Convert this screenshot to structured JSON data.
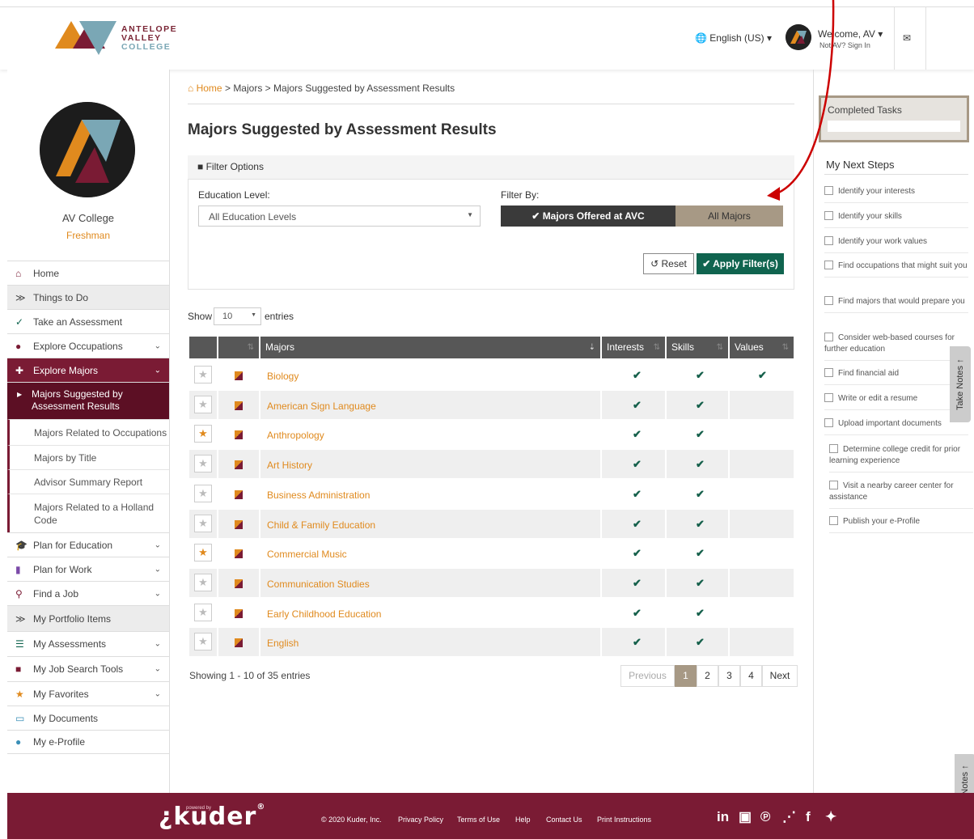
{
  "header": {
    "logo_lines": [
      "ANTELOPE",
      "VALLEY",
      "COLLEGE"
    ],
    "language": "English (US)",
    "welcome": "Welcome, AV",
    "signin": "Not AV? Sign In"
  },
  "sidebar": {
    "name": "AV College",
    "year": "Freshman",
    "nav": [
      {
        "label": "Home"
      },
      {
        "label": "Things to Do"
      },
      {
        "label": "Take an Assessment"
      },
      {
        "label": "Explore Occupations"
      },
      {
        "label": "Explore Majors"
      },
      {
        "label": "Majors Suggested by Assessment Results"
      },
      {
        "label": "Majors Related to Occupations"
      },
      {
        "label": "Majors by Title"
      },
      {
        "label": "Advisor Summary Report"
      },
      {
        "label": "Majors Related to a Holland Code"
      },
      {
        "label": "Plan for Education"
      },
      {
        "label": "Plan for Work"
      },
      {
        "label": "Find a Job"
      },
      {
        "label": "My Portfolio Items"
      },
      {
        "label": "My Assessments"
      },
      {
        "label": "My Job Search Tools"
      },
      {
        "label": "My Favorites"
      },
      {
        "label": "My Documents"
      },
      {
        "label": "My e-Profile"
      }
    ]
  },
  "breadcrumb": {
    "home": "Home",
    "sep": ">",
    "b1": "Majors",
    "b2": "Majors Suggested by Assessment Results"
  },
  "main": {
    "title": "Majors Suggested by Assessment Results",
    "filter": {
      "heading": "Filter Options",
      "edu_label": "Education Level:",
      "edu_value": "All Education Levels",
      "filterby_label": "Filter By:",
      "seg_left": "Majors Offered at AVC",
      "seg_right": "All Majors",
      "reset": "Reset",
      "apply": "Apply Filter(s)"
    },
    "show_label": "Show",
    "show_value": "10",
    "entries_label": "entries"
  },
  "table": {
    "headers": {
      "majors": "Majors",
      "interests": "Interests",
      "skills": "Skills",
      "values": "Values"
    },
    "rows": [
      {
        "name": "Biology",
        "fav": false,
        "interests": true,
        "skills": true,
        "values": true
      },
      {
        "name": "American Sign Language",
        "fav": false,
        "interests": true,
        "skills": true,
        "values": false
      },
      {
        "name": "Anthropology",
        "fav": true,
        "interests": true,
        "skills": true,
        "values": false
      },
      {
        "name": "Art History",
        "fav": false,
        "interests": true,
        "skills": true,
        "values": false
      },
      {
        "name": "Business Administration",
        "fav": false,
        "interests": true,
        "skills": true,
        "values": false
      },
      {
        "name": "Child & Family Education",
        "fav": false,
        "interests": true,
        "skills": true,
        "values": false
      },
      {
        "name": "Commercial Music",
        "fav": true,
        "interests": true,
        "skills": true,
        "values": false
      },
      {
        "name": "Communication Studies",
        "fav": false,
        "interests": true,
        "skills": true,
        "values": false
      },
      {
        "name": "Early Childhood Education",
        "fav": false,
        "interests": true,
        "skills": true,
        "values": false
      },
      {
        "name": "English",
        "fav": false,
        "interests": true,
        "skills": true,
        "values": false
      }
    ],
    "showing": "Showing 1 - 10 of 35 entries",
    "pagination": {
      "prev": "Previous",
      "pages": [
        "1",
        "2",
        "3",
        "4"
      ],
      "next": "Next",
      "current": "1"
    }
  },
  "right": {
    "completed": "Completed Tasks",
    "next_steps": "My Next Steps",
    "steps": [
      "Identify your interests",
      "Identify your skills",
      "Identify your work values",
      "Find occupations that might suit you",
      "Find majors that would prepare you",
      "Consider web-based courses for further education",
      "Find financial aid",
      "Write or edit a resume",
      "Upload important documents",
      "Determine college credit for prior learning experience",
      "Visit a nearby career center for assistance",
      "Publish your e-Profile"
    ],
    "take_notes": "Take Notes"
  },
  "footer": {
    "brand": "kuder",
    "powered": "powered by",
    "links": [
      "© 2020 Kuder, Inc.",
      "Privacy Policy",
      "Terms of Use",
      "Help",
      "Contact Us",
      "Print Instructions"
    ]
  },
  "colors": {
    "maroon": "#7a1b34",
    "orange": "#e08a1e",
    "green": "#10644f",
    "taupe": "#a79985"
  }
}
